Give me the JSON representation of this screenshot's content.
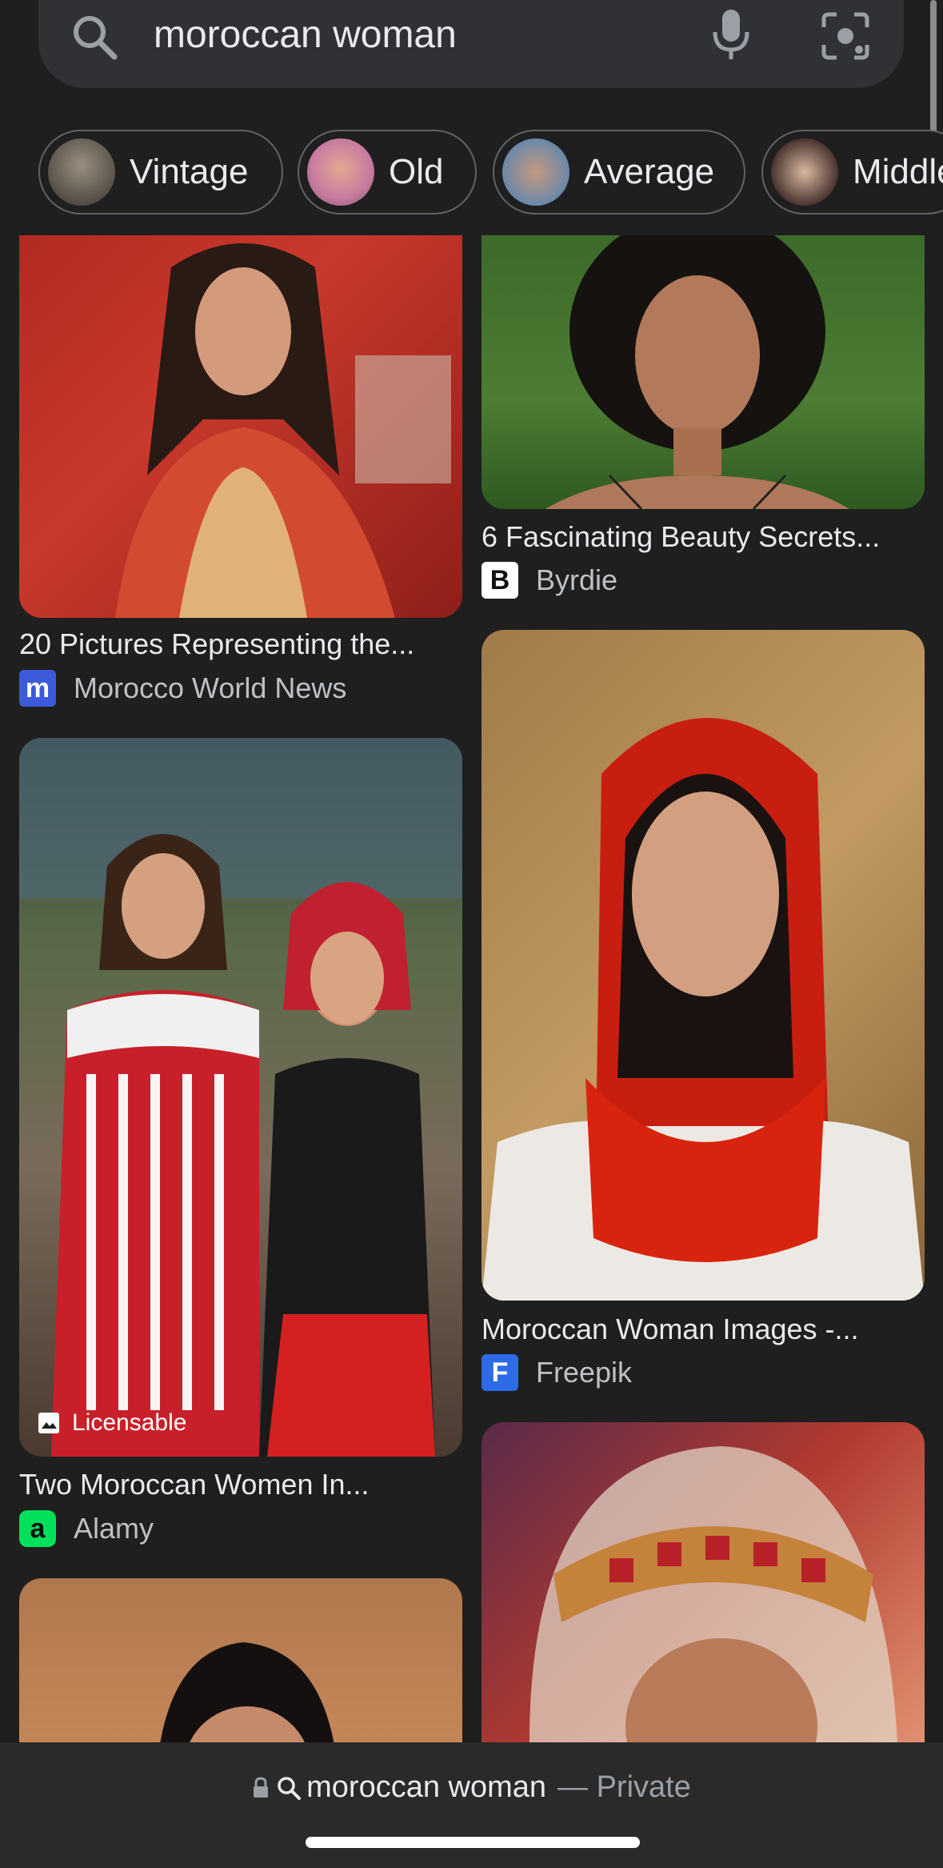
{
  "search": {
    "query": "moroccan woman",
    "icons": {
      "search": "search-icon",
      "mic": "mic-icon",
      "lens": "lens-icon"
    }
  },
  "chips": [
    {
      "label": "Vintage"
    },
    {
      "label": "Old"
    },
    {
      "label": "Average"
    },
    {
      "label": "Middle"
    }
  ],
  "results": {
    "left": [
      {
        "title": "20 Pictures Representing the...",
        "source": "Morocco World News",
        "logo_text": "m"
      },
      {
        "title": "Two Moroccan Women In...",
        "source": "Alamy",
        "logo_text": "a",
        "badge": "Licensable"
      }
    ],
    "right": [
      {
        "title": "6 Fascinating Beauty Secrets...",
        "source": "Byrdie",
        "logo_text": "B"
      },
      {
        "title": "Moroccan Woman Images -...",
        "source": "Freepik",
        "logo_text": "F"
      }
    ]
  },
  "bottom_bar": {
    "query": "moroccan woman",
    "separator": "— Private"
  },
  "colors": {
    "background": "#1f1f1f",
    "search_bar": "#303134",
    "text": "#e8eaed",
    "secondary_text": "#bdc1c6"
  }
}
